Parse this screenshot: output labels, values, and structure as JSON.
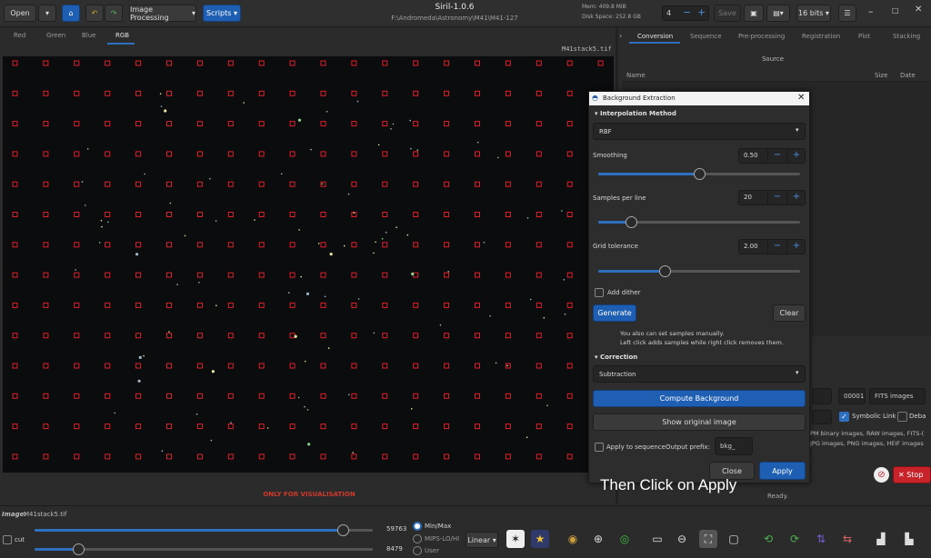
{
  "app": {
    "title": "Siril-1.0.6",
    "subtitle": "F:\\Andromeda\\Astronomy\\M41\\M41-127",
    "mem": "Mem: 409.8 MiB",
    "disk": "Disk Space: 252.8 GB"
  },
  "toolbar": {
    "open_label": "Open",
    "image_processing_label": "Image Processing",
    "scripts_label": "Scripts",
    "threads_value": "4",
    "save_label": "Save",
    "bits_label": "16 bits"
  },
  "channel_tabs": [
    "Red",
    "Green",
    "Blue",
    "RGB"
  ],
  "active_channel": "RGB",
  "image_filename": "M41stack5.tif",
  "viz_note": "ONLY FOR VISUALISATION",
  "right_panel": {
    "tabs": [
      "Conversion",
      "Sequence",
      "Pre-processing",
      "Registration",
      "Plot",
      "Stacking"
    ],
    "active_tab": "Conversion",
    "source_label": "Source",
    "col_name": "Name",
    "col_size": "Size",
    "col_date": "Date",
    "index_value": "00001",
    "fits_images_label": "FITS images",
    "symbolic_link_label": "Symbolic Link",
    "debayer_label": "Deba",
    "formats_line1": "PM binary images, RAW images, FITS-(",
    "formats_line2": "JPG images, PNG images, HEIF images",
    "stop_label": "Stop",
    "ready_label": "Ready."
  },
  "dialog": {
    "title": "Background Extraction",
    "interpolation_section": "Interpolation Method",
    "interpolation_value": "RBF",
    "smoothing_label": "Smoothing",
    "smoothing_value": "0.50",
    "smoothing_fraction": 0.5,
    "samples_label": "Samples per line",
    "samples_value": "20",
    "samples_fraction": 0.16,
    "tolerance_label": "Grid tolerance",
    "tolerance_value": "2.00",
    "tolerance_fraction": 0.33,
    "add_dither_label": "Add dither",
    "generate_label": "Generate",
    "clear_label": "Clear",
    "help_line1": "You also can set samples manually.",
    "help_line2": "Left click adds samples while right click removes them.",
    "correction_section": "Correction",
    "correction_value": "Subtraction",
    "compute_label": "Compute Background",
    "show_original_label": "Show original image",
    "apply_sequence_label": "Apply to sequence",
    "output_prefix_label": "Output prefix:",
    "output_prefix_value": "bkg_",
    "close_label": "Close",
    "apply_label": "Apply"
  },
  "bottom": {
    "image_label": "Image:",
    "image_name": "M41stack5.tif",
    "cut_label": "cut",
    "max_value": "59763",
    "min_value": "8479",
    "max_fraction": 0.91,
    "min_fraction": 0.13,
    "mode_minmax": "Min/Max",
    "mode_mips": "MIPS-LO/HI",
    "mode_user": "User",
    "scale_label": "Linear"
  },
  "caption": "Then Click on Apply",
  "colors": {
    "accent": "#1f5fb3",
    "sample_box": "#e0202a",
    "stop": "#c8232b"
  }
}
